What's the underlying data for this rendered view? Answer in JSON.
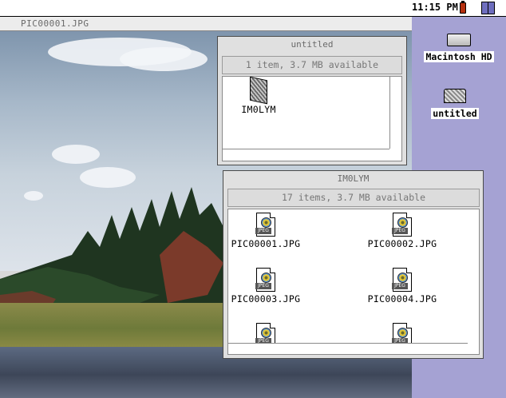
{
  "menubar": {
    "clock": "11:15 PM",
    "battery_icon": "battery-icon",
    "app_menu_icon": "finder-icon"
  },
  "desktop": {
    "background_color": "#a5a2d3",
    "icons": [
      {
        "label": "Macintosh HD",
        "icon": "hard-drive-icon"
      },
      {
        "label": "untitled",
        "icon": "disk-icon"
      }
    ]
  },
  "photo_window": {
    "title": "PIC00001.JPG"
  },
  "untitled_window": {
    "title": "untitled",
    "info": "1 item, 3.7 MB available",
    "items": [
      {
        "label": "IM0LYM",
        "icon": "folder-icon"
      }
    ]
  },
  "imolym_window": {
    "title": "IM0LYM",
    "info": "17 items, 3.7 MB available",
    "items": [
      {
        "label": "PIC00001.JPG",
        "icon": "jpeg-file-icon",
        "tag": "JPEG"
      },
      {
        "label": "PIC00002.JPG",
        "icon": "jpeg-file-icon",
        "tag": "JPEG"
      },
      {
        "label": "PIC00003.JPG",
        "icon": "jpeg-file-icon",
        "tag": "JPEG"
      },
      {
        "label": "PIC00004.JPG",
        "icon": "jpeg-file-icon",
        "tag": "JPEG"
      },
      {
        "label": "",
        "icon": "jpeg-file-icon",
        "tag": "JPEG"
      },
      {
        "label": "",
        "icon": "jpeg-file-icon",
        "tag": "JPEG"
      }
    ]
  }
}
